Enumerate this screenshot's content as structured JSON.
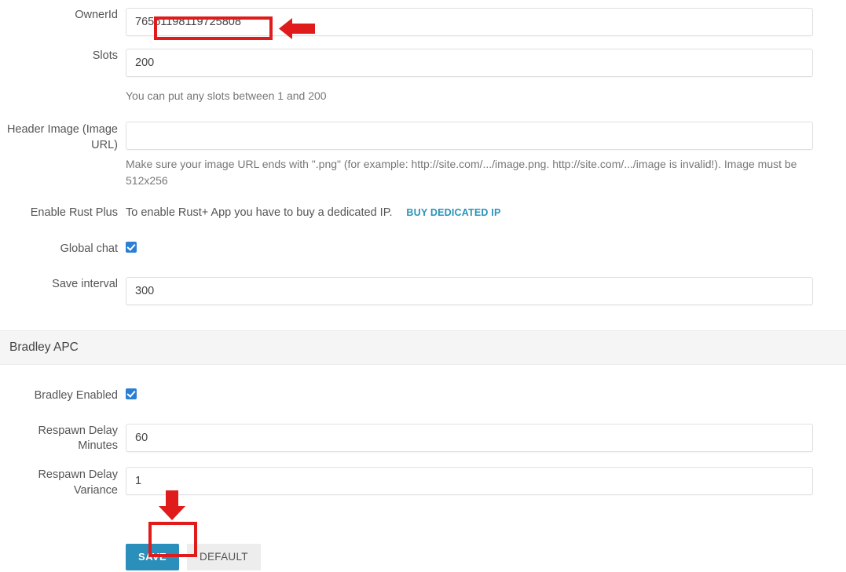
{
  "form": {
    "fields": [
      {
        "key": "owner_id",
        "label": "OwnerId",
        "value": "76561198119725808",
        "placeholder": ""
      },
      {
        "key": "slots",
        "label": "Slots",
        "value": "200",
        "placeholder": "",
        "help": "You can put any slots between 1 and 200"
      },
      {
        "key": "header_image",
        "label": "Header Image (Image URL)",
        "value": "",
        "placeholder": "",
        "help": "Make sure your image URL ends with \".png\" (for example: http://site.com/.../image.png. http://site.com/.../image is invalid!). Image must be 512x256"
      },
      {
        "key": "enable_rust_plus",
        "label": "Enable Rust Plus",
        "text": "To enable Rust+ App you have to buy a dedicated IP.",
        "link_label": "BUY DEDICATED IP"
      },
      {
        "key": "global_chat",
        "label": "Global chat",
        "checked": true
      },
      {
        "key": "save_interval",
        "label": "Save interval",
        "value": "300",
        "placeholder": ""
      }
    ],
    "section": {
      "title": "Bradley APC",
      "fields": [
        {
          "key": "bradley_enabled",
          "label": "Bradley Enabled",
          "checked": true
        },
        {
          "key": "respawn_delay_minutes",
          "label": "Respawn Delay Minutes",
          "value": "60",
          "placeholder": ""
        },
        {
          "key": "respawn_delay_variance",
          "label": "Respawn Delay Variance",
          "value": "1",
          "placeholder": ""
        }
      ]
    },
    "actions": {
      "save_label": "SAVE",
      "default_label": "DEFAULT"
    }
  },
  "colors": {
    "accent": "#2a8fba",
    "link": "#2a93ba",
    "checkbox": "#2a7fd4",
    "annotation": "#e01b1b",
    "section_band": "#f5f5f5"
  },
  "annotations": [
    {
      "key": "owner-id-highlight",
      "kind": "box"
    },
    {
      "key": "owner-id-arrow",
      "kind": "arrow-left"
    },
    {
      "key": "save-arrow",
      "kind": "arrow-down"
    },
    {
      "key": "save-highlight",
      "kind": "box"
    }
  ]
}
